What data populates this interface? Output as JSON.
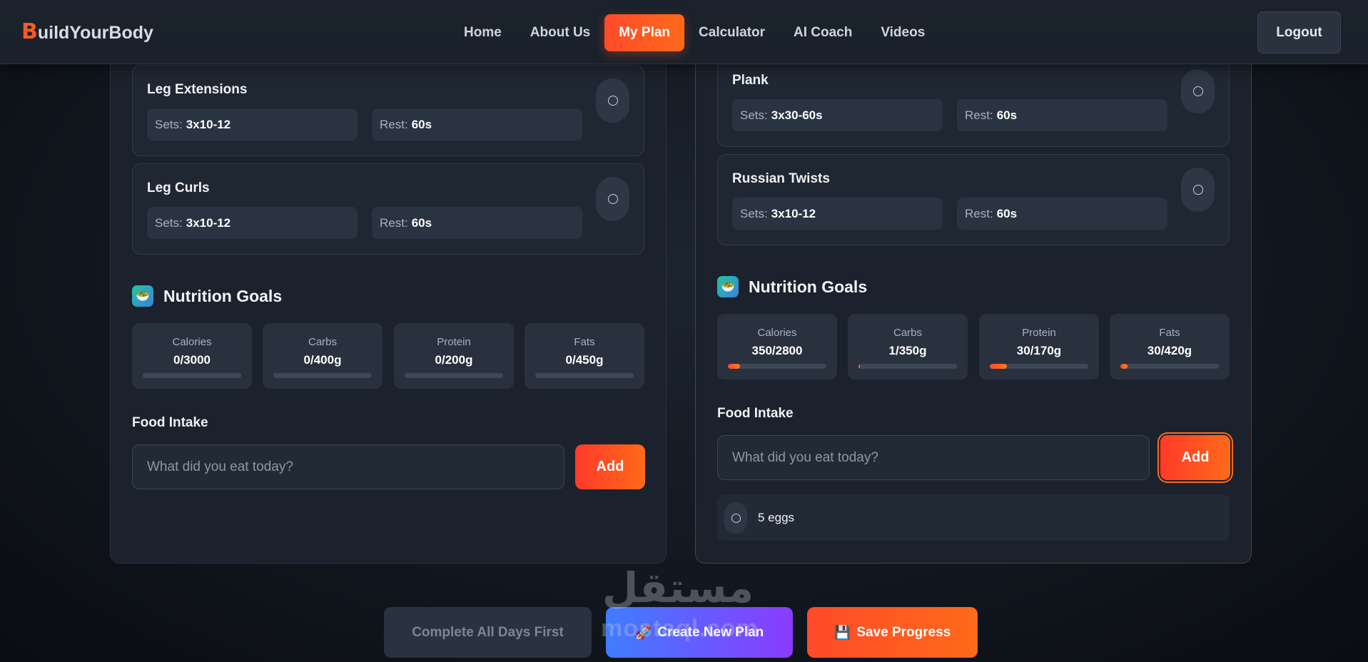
{
  "brand": {
    "initial": "B",
    "rest": "uildYourBody"
  },
  "nav": {
    "links": [
      {
        "label": "Home",
        "active": false
      },
      {
        "label": "About Us",
        "active": false
      },
      {
        "label": "My Plan",
        "active": true
      },
      {
        "label": "Calculator",
        "active": false
      },
      {
        "label": "AI Coach",
        "active": false
      },
      {
        "label": "Videos",
        "active": false
      }
    ],
    "logout": "Logout"
  },
  "labels": {
    "sets": "Sets:",
    "rest": "Rest:"
  },
  "left": {
    "exercises": [
      {
        "name": "Leg Extensions",
        "sets": "3x10-12",
        "rest": "60s"
      },
      {
        "name": "Leg Curls",
        "sets": "3x10-12",
        "rest": "60s"
      }
    ],
    "nutrition": {
      "title": "Nutrition Goals",
      "icon": "🥗",
      "stats": [
        {
          "label": "Calories",
          "value": "0/3000",
          "progress": 0
        },
        {
          "label": "Carbs",
          "value": "0/400g",
          "progress": 0
        },
        {
          "label": "Protein",
          "value": "0/200g",
          "progress": 0
        },
        {
          "label": "Fats",
          "value": "0/450g",
          "progress": 0
        }
      ]
    },
    "food": {
      "label": "Food Intake",
      "placeholder": "What did you eat today?",
      "add": "Add"
    }
  },
  "right": {
    "exercises": [
      {
        "name": "Plank",
        "sets": "3x30-60s",
        "rest": "60s"
      },
      {
        "name": "Russian Twists",
        "sets": "3x10-12",
        "rest": "60s"
      }
    ],
    "nutrition": {
      "title": "Nutrition Goals",
      "icon": "🥗",
      "stats": [
        {
          "label": "Calories",
          "value": "350/2800",
          "progress": 0.125
        },
        {
          "label": "Carbs",
          "value": "1/350g",
          "progress": 0.003
        },
        {
          "label": "Protein",
          "value": "30/170g",
          "progress": 0.176
        },
        {
          "label": "Fats",
          "value": "30/420g",
          "progress": 0.071
        }
      ]
    },
    "food": {
      "label": "Food Intake",
      "placeholder": "What did you eat today?",
      "add": "Add"
    },
    "food_items": [
      "5 eggs"
    ]
  },
  "actions": {
    "complete": "Complete All Days First",
    "create": "Create New Plan",
    "create_icon": "🚀",
    "save": "Save Progress",
    "save_icon": "💾"
  },
  "watermark": {
    "arabic": "مستقل",
    "latin": "mostaql.com"
  }
}
